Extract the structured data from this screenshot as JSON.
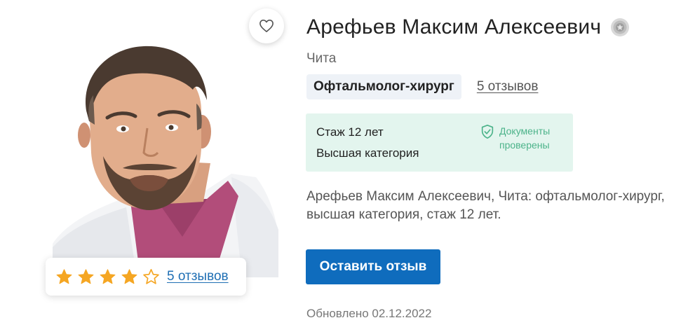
{
  "doctor": {
    "name": "Арефьев Максим Алексеевич",
    "city": "Чита",
    "specialty": "Офтальмолог-хирург",
    "reviews_link": "5 отзывов",
    "description": "Арефьев Максим Алексеевич, Чита: офтальмолог-хирург, высшая категория, стаж 12 лет.",
    "updated": "Обновлено 02.12.2022"
  },
  "experience": {
    "years": "Стаж 12 лет",
    "category": "Высшая категория",
    "documents_line1": "Документы",
    "documents_line2": "проверены"
  },
  "rating": {
    "stars": 4,
    "max_stars": 5,
    "reviews_link": "5 отзывов"
  },
  "actions": {
    "leave_review": "Оставить отзыв"
  },
  "icons": {
    "favorite": "heart-icon",
    "badge": "award-badge-icon",
    "documents": "shield-check-icon",
    "star": "star-icon"
  },
  "colors": {
    "accent": "#0f6cbd",
    "link": "#1f6fb4",
    "star": "#f5a623",
    "experience_bg": "#e3f5ee",
    "documents_green": "#4cb38a",
    "chip_bg": "#eef2f7"
  }
}
